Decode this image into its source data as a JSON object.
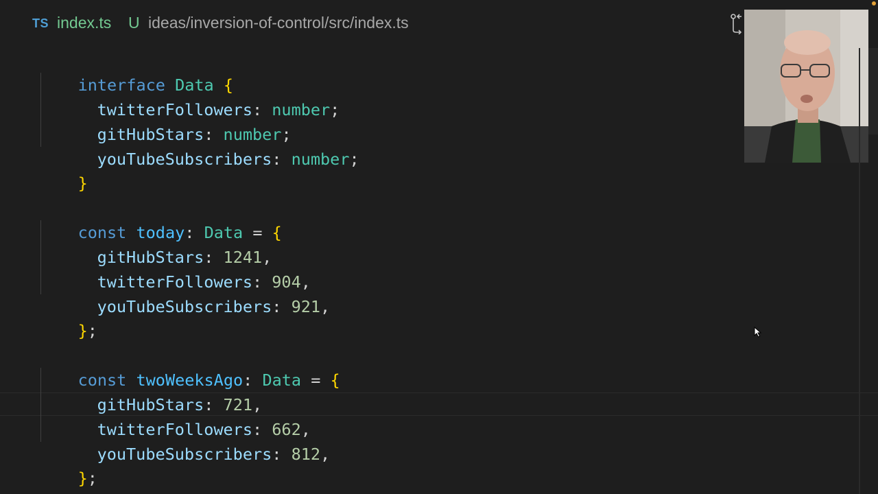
{
  "tab": {
    "lang_badge": "TS",
    "filename": "index.ts",
    "status": "U",
    "path": "ideas/inversion-of-control/src/index.ts"
  },
  "code": {
    "interface": {
      "kw": "interface",
      "name": "Data",
      "open": "{",
      "fields": [
        {
          "name": "twitterFollowers",
          "sep": ":",
          "type": "number",
          "end": ";"
        },
        {
          "name": "gitHubStars",
          "sep": ":",
          "type": "number",
          "end": ";"
        },
        {
          "name": "youTubeSubscribers",
          "sep": ":",
          "type": "number",
          "end": ";"
        }
      ],
      "close": "}"
    },
    "today": {
      "kw": "const",
      "name": "today",
      "sep": ":",
      "type": "Data",
      "eq": "=",
      "open": "{",
      "fields": [
        {
          "name": "gitHubStars",
          "sep": ":",
          "value": "1241",
          "end": ","
        },
        {
          "name": "twitterFollowers",
          "sep": ":",
          "value": "904",
          "end": ","
        },
        {
          "name": "youTubeSubscribers",
          "sep": ":",
          "value": "921",
          "end": ","
        }
      ],
      "close": "}",
      "semi": ";"
    },
    "twoWeeksAgo": {
      "kw": "const",
      "name": "twoWeeksAgo",
      "sep": ":",
      "type": "Data",
      "eq": "=",
      "open": "{",
      "fields": [
        {
          "name": "gitHubStars",
          "sep": ":",
          "value": "721",
          "end": ","
        },
        {
          "name": "twitterFollowers",
          "sep": ":",
          "value": "662",
          "end": ","
        },
        {
          "name": "youTubeSubscribers",
          "sep": ":",
          "value": "812",
          "end": ","
        }
      ],
      "close": "}",
      "semi": ";"
    }
  },
  "colors": {
    "background": "#1e1e1e",
    "keyword": "#569cd6",
    "type": "#4ec9b0",
    "property": "#9cdcfe",
    "number": "#b5cea8",
    "brace": "#ffd700",
    "untracked": "#73c991"
  },
  "icons": {
    "compare": "git-compare-icon",
    "cursor": "mouse-pointer-icon"
  }
}
